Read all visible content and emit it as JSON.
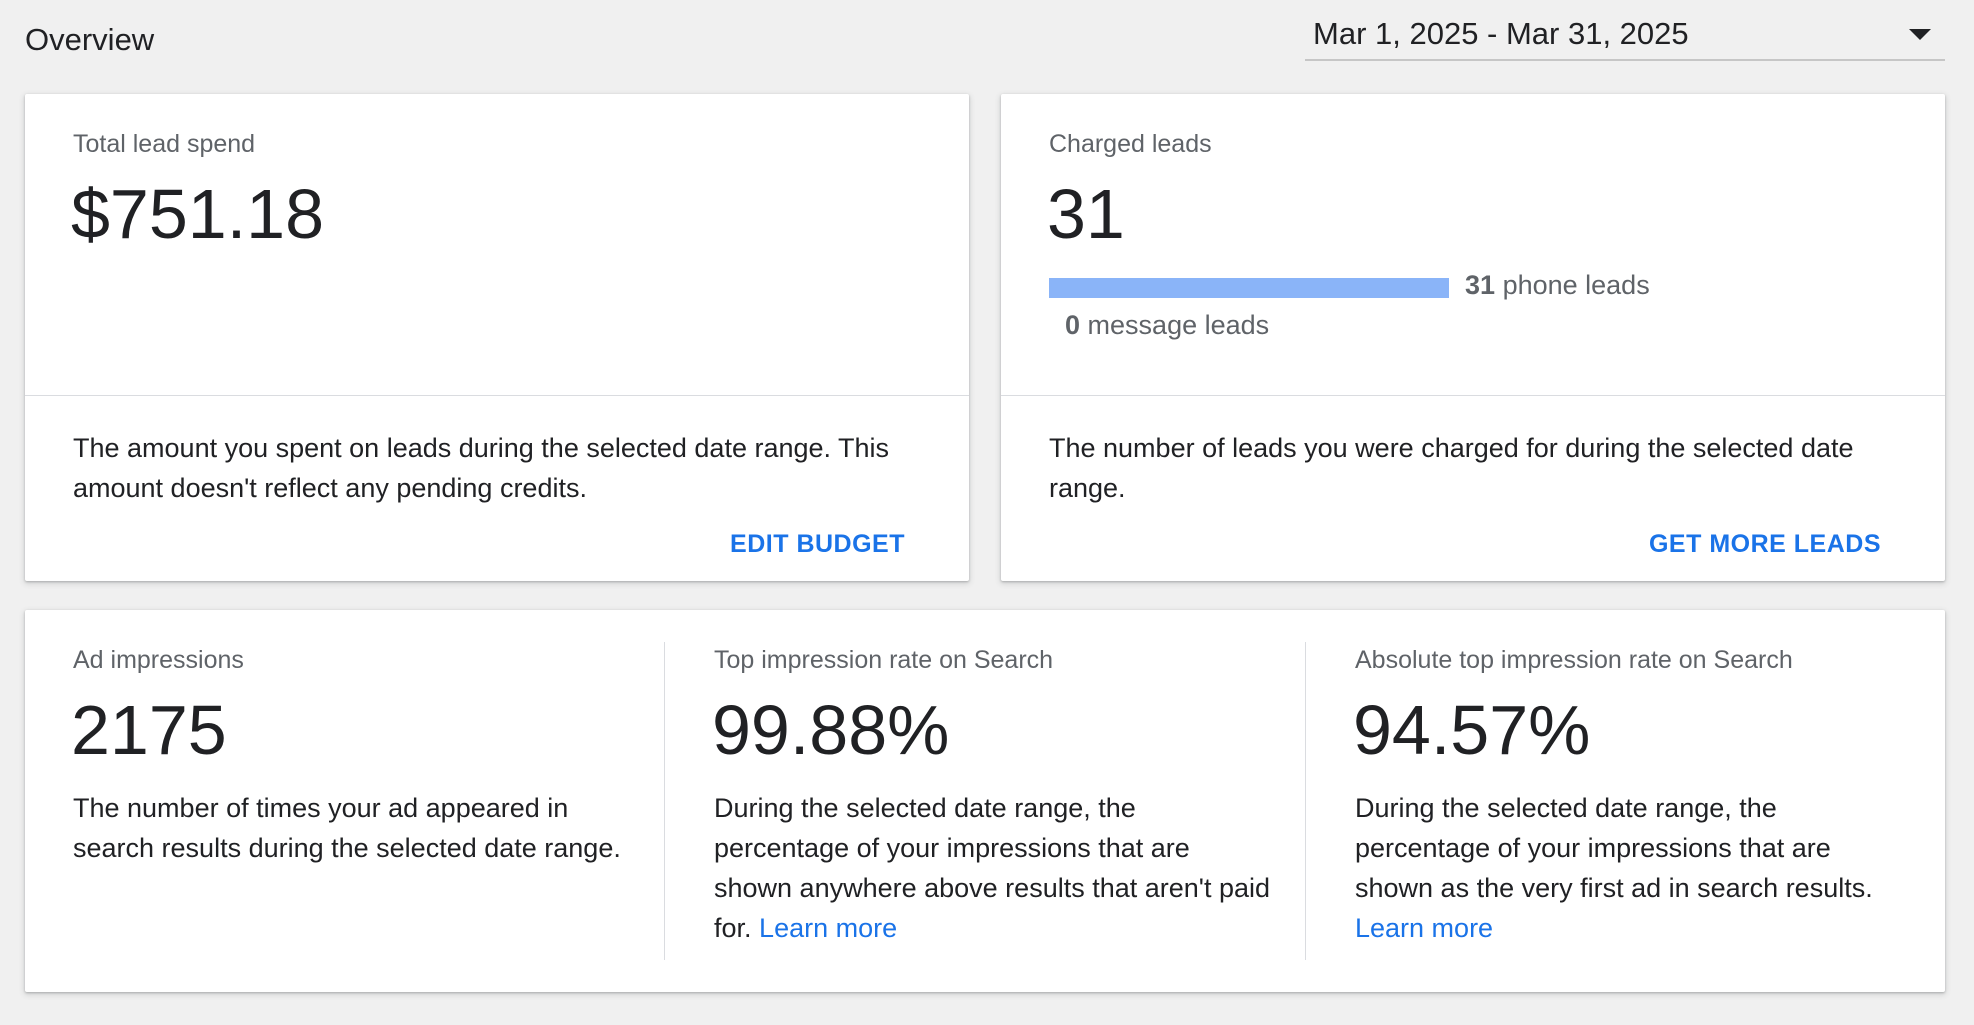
{
  "header": {
    "title": "Overview",
    "date_range": "Mar 1, 2025 - Mar 31, 2025",
    "date_caret_icon": "caret-down-icon"
  },
  "spend_card": {
    "label": "Total lead spend",
    "value": "$751.18",
    "description": "The amount you spent on leads during the selected date range. This amount doesn't reflect any pending credits.",
    "action": "EDIT BUDGET"
  },
  "leads_card": {
    "label": "Charged leads",
    "value": "31",
    "phone_count": "31",
    "phone_label": "phone leads",
    "message_count": "0",
    "message_label": "message leads",
    "phone_share": 1.0,
    "bar_color": "#8ab4f8",
    "description": "The number of leads you were charged for during the selected date range.",
    "action": "GET MORE LEADS"
  },
  "impressions_card": {
    "columns": [
      {
        "label": "Ad impressions",
        "value": "2175",
        "description": "The number of times your ad appeared in search results during the selected date range.",
        "link": ""
      },
      {
        "label": "Top impression rate on Search",
        "value": "99.88%",
        "description": "During the selected date range, the percentage of your impressions that are shown anywhere above results that aren't paid for.",
        "link": "Learn more"
      },
      {
        "label": "Absolute top impression rate on Search",
        "value": "94.57%",
        "description": "During the selected date range, the percentage of your impressions that are shown as the very first ad in search results.",
        "link": "Learn more"
      }
    ]
  },
  "colors": {
    "accent": "#1a73e8",
    "background": "#f0f0f0",
    "card": "#ffffff"
  }
}
